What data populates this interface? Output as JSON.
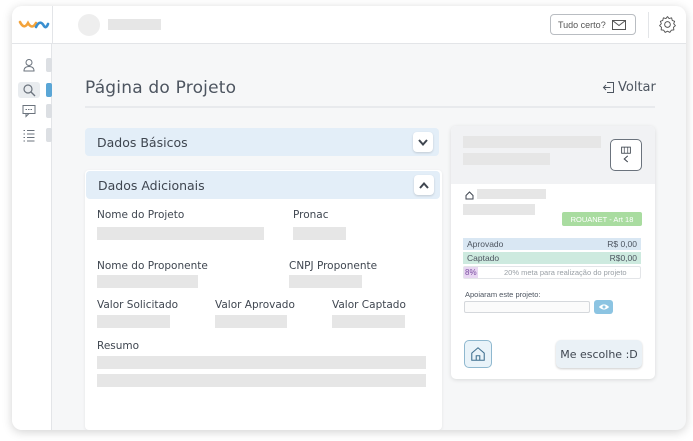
{
  "topbar": {
    "status_label": "Tudo certo?"
  },
  "sidebar": {
    "items": [
      {
        "icon": "user-icon"
      },
      {
        "icon": "search-icon"
      },
      {
        "icon": "chat-icon"
      },
      {
        "icon": "list-icon"
      }
    ]
  },
  "page": {
    "title": "Página do Projeto",
    "back_label": "Voltar"
  },
  "accordions": {
    "basicos": "Dados Básicos",
    "adicionais": "Dados Adicionais"
  },
  "fields": {
    "nome_projeto": "Nome do Projeto",
    "pronac": "Pronac",
    "nome_proponente": "Nome do Proponente",
    "cnpj_proponente": "CNPJ Proponente",
    "valor_solicitado": "Valor Solicitado",
    "valor_aprovado": "Valor Aprovado",
    "valor_captado": "Valor Captado",
    "resumo": "Resumo"
  },
  "card": {
    "badge": "ROUANET - Art 18",
    "aprovado_label": "Aprovado",
    "aprovado_value": "R$ 0,00",
    "captado_label": "Captado",
    "captado_value": "R$0,00",
    "percent": "8%",
    "percent_fraction": 0.08,
    "percent_text": "20% meta para realização do projeto",
    "apoio_label": "Apoiaram este projeto:",
    "choose_label": "Me escolhe :D"
  },
  "colors": {
    "accent_blue": "#e3eef8",
    "badge_green": "#a9dca0",
    "aprovado_bg": "#d9e7f3",
    "captado_bg": "#cdeadf",
    "percent_purple": "#e8d6f2"
  }
}
